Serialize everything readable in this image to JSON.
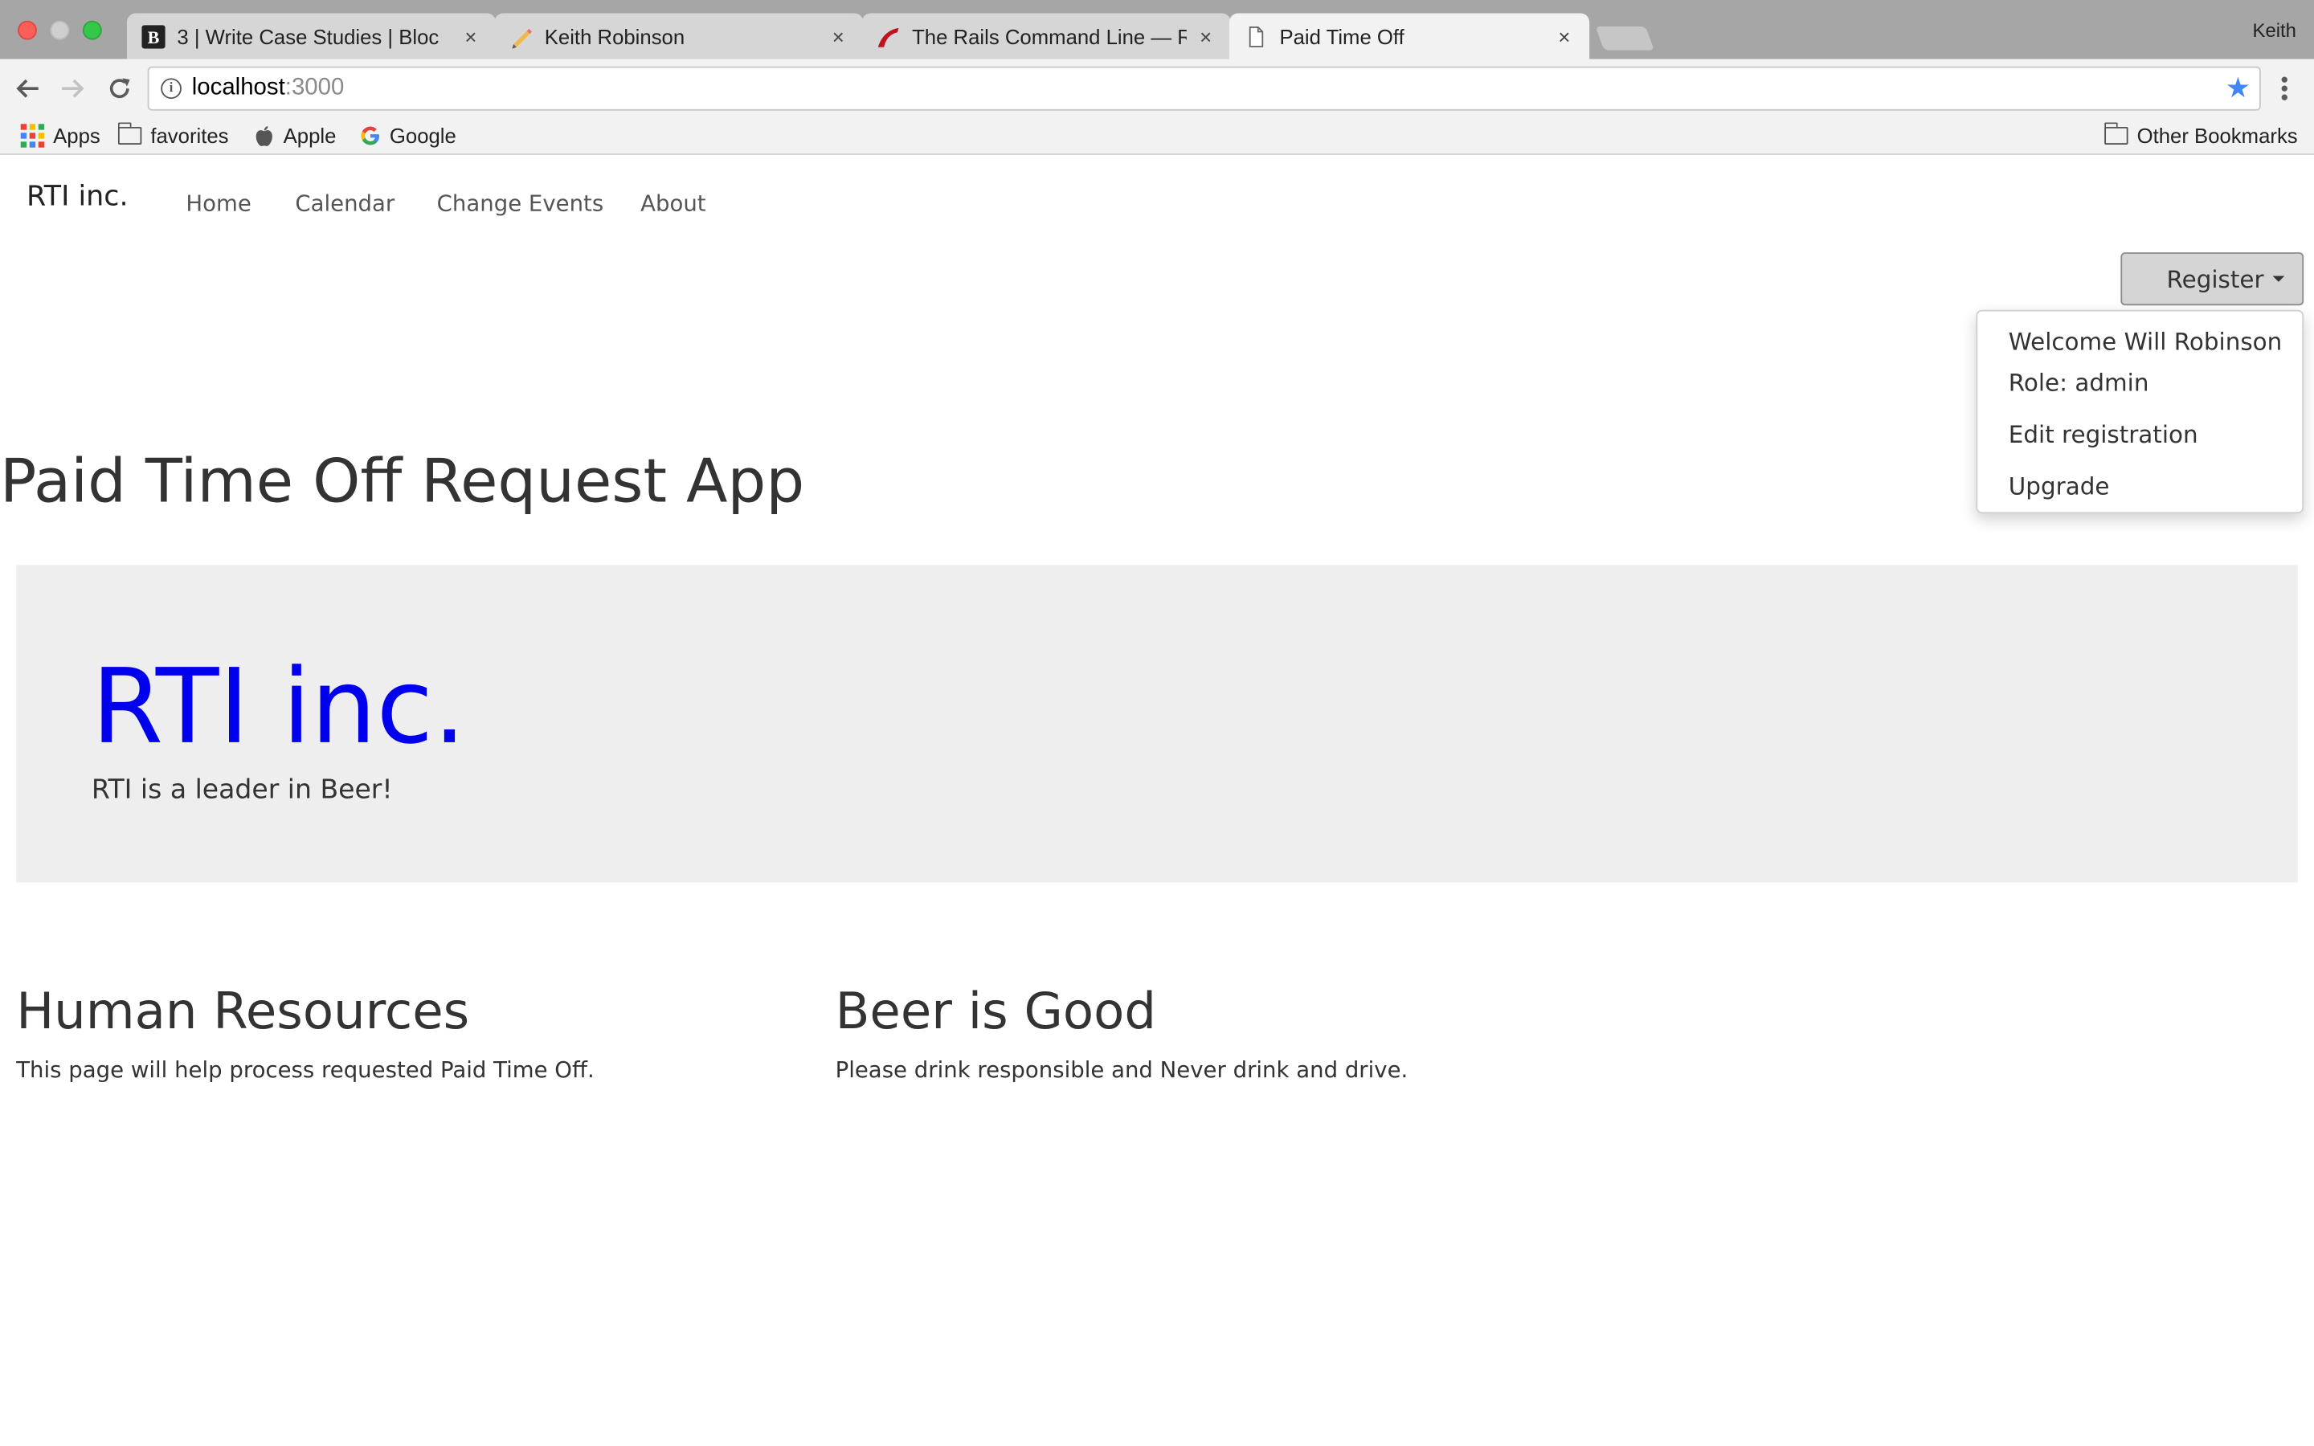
{
  "browser": {
    "tabs": [
      {
        "title": "3 | Write Case Studies | Bloc",
        "favicon": "bloc-b-icon",
        "active": false
      },
      {
        "title": "Keith Robinson",
        "favicon": "pencil-icon",
        "active": false
      },
      {
        "title": "The Rails Command Line — Ru",
        "favicon": "rails-icon",
        "active": false
      },
      {
        "title": "Paid Time Off",
        "favicon": "document-icon",
        "active": true
      }
    ],
    "tab_close": "×",
    "profile_name": "Keith",
    "url_host": "localhost",
    "url_port": ":3000",
    "bookmarks": [
      {
        "label": "Apps",
        "icon": "apps-grid-icon"
      },
      {
        "label": "favorites",
        "icon": "folder-icon"
      },
      {
        "label": "Apple",
        "icon": "apple-icon"
      },
      {
        "label": "Google",
        "icon": "google-icon"
      }
    ],
    "other_bookmarks": "Other Bookmarks",
    "colors": {
      "tabstrip": "#a6a6a6",
      "toolbar": "#f2f2f2",
      "star": "#4285f4"
    }
  },
  "app": {
    "brand": "RTI inc.",
    "nav": [
      "Home",
      "Calendar",
      "Change Events",
      "About"
    ],
    "register_button": "Register",
    "dropdown": {
      "welcome": "Welcome Will Robinson",
      "role": "Role: admin",
      "edit": "Edit registration",
      "upgrade": "Upgrade"
    },
    "page_title": "Paid Time Off Request App",
    "jumbotron": {
      "title": "RTI inc.",
      "text": "RTI is a leader in Beer!",
      "title_color": "#0000ee",
      "background": "#eeeeee"
    },
    "columns": [
      {
        "heading": "Human Resources",
        "text": "This page will help process requested Paid Time Off."
      },
      {
        "heading": "Beer is Good",
        "text": "Please drink responsible and Never drink and drive."
      }
    ]
  }
}
